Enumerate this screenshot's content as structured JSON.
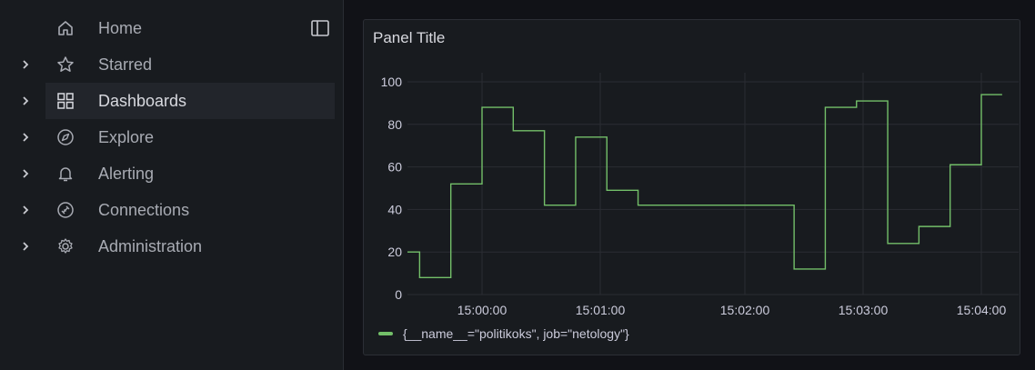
{
  "sidebar": {
    "items": [
      {
        "label": "Home",
        "icon": "home-icon",
        "expandable": false
      },
      {
        "label": "Starred",
        "icon": "star-icon",
        "expandable": true
      },
      {
        "label": "Dashboards",
        "icon": "grid-icon",
        "expandable": true,
        "active": true
      },
      {
        "label": "Explore",
        "icon": "compass-icon",
        "expandable": true
      },
      {
        "label": "Alerting",
        "icon": "bell-icon",
        "expandable": true
      },
      {
        "label": "Connections",
        "icon": "plug-icon",
        "expandable": true
      },
      {
        "label": "Administration",
        "icon": "gear-icon",
        "expandable": true
      }
    ],
    "dock_icon": "dock-sidebar-icon"
  },
  "panel": {
    "title": "Panel Title"
  },
  "colors": {
    "series": "#73bf69",
    "accent_active": "#f55f3e"
  },
  "chart_data": {
    "type": "line",
    "title": "Panel Title",
    "ylim": [
      0,
      100
    ],
    "y_ticks": [
      "0",
      "20",
      "40",
      "60",
      "80",
      "100"
    ],
    "x_ticks": [
      "15:00:00",
      "15:01:00",
      "15:02:00",
      "15:03:00",
      "15:04:00"
    ],
    "grid": true,
    "legend_placement": "bottom-left",
    "series": [
      {
        "name": "{__name__=\"politikoks\", job=\"netology\"}",
        "color": "#73bf69",
        "step": true,
        "x": [
          "14:59:15",
          "14:59:30",
          "14:59:45",
          "15:00:00",
          "15:00:15",
          "15:00:30",
          "15:00:45",
          "15:01:00",
          "15:01:15",
          "15:01:30",
          "15:01:45",
          "15:02:00",
          "15:02:15",
          "15:02:30",
          "15:02:45",
          "15:03:00",
          "15:03:15",
          "15:03:30",
          "15:03:45",
          "15:04:00",
          "15:04:10"
        ],
        "values": [
          20,
          8,
          52,
          88,
          77,
          42,
          74,
          49,
          42,
          42,
          42,
          42,
          42,
          12,
          88,
          91,
          24,
          32,
          61,
          94,
          94
        ]
      }
    ]
  }
}
